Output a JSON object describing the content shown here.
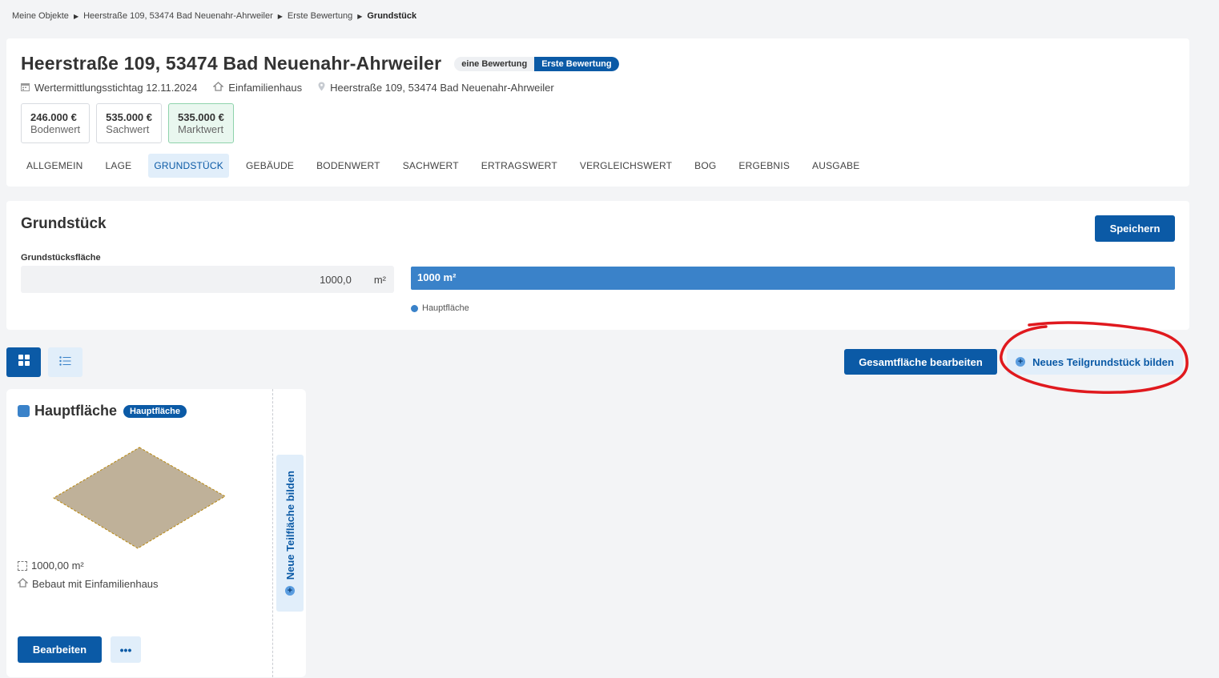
{
  "breadcrumb": {
    "items": [
      "Meine Objekte",
      "Heerstraße 109, 53474 Bad Neuenahr-Ahrweiler",
      "Erste Bewertung"
    ],
    "current": "Grundstück"
  },
  "header": {
    "title": "Heerstraße 109, 53474 Bad Neuenahr-Ahrweiler",
    "badge_count": "eine Bewertung",
    "badge_name": "Erste Bewertung",
    "meta": {
      "date": "Wertermittlungsstichtag 12.11.2024",
      "type": "Einfamilienhaus",
      "address": "Heerstraße 109, 53474 Bad Neuenahr-Ahrweiler"
    },
    "values": [
      {
        "amount": "246.000 €",
        "label": "Bodenwert"
      },
      {
        "amount": "535.000 €",
        "label": "Sachwert"
      },
      {
        "amount": "535.000 €",
        "label": "Marktwert"
      }
    ],
    "tabs": [
      "ALLGEMEIN",
      "LAGE",
      "GRUNDSTÜCK",
      "GEBÄUDE",
      "BODENWERT",
      "SACHWERT",
      "ERTRAGSWERT",
      "VERGLEICHSWERT",
      "BOG",
      "ERGEBNIS",
      "AUSGABE"
    ]
  },
  "section": {
    "title": "Grundstück",
    "save_label": "Speichern",
    "field_label": "Grundstücksfläche",
    "area_value": "1000,0",
    "area_unit": "m²",
    "bar_label": "1000 m²",
    "legend_label": "Hauptfläche"
  },
  "actions": {
    "total_area_label": "Gesamtfläche bearbeiten",
    "new_plot_label": "Neues Teilgrundstück bilden"
  },
  "plot": {
    "name": "Hauptfläche",
    "badge": "Hauptfläche",
    "area": "1000,00 m²",
    "usage": "Bebaut mit Einfamilienhaus",
    "edit_label": "Bearbeiten",
    "more_label": "•••",
    "new_subarea_label": "Neue Teilfläche bilden"
  },
  "colors": {
    "primary": "#0b5aa6",
    "bar": "#3a82c9",
    "light_blue": "#e1eefa",
    "plot_fill": "#bfb199",
    "annotation": "#e0191e"
  }
}
